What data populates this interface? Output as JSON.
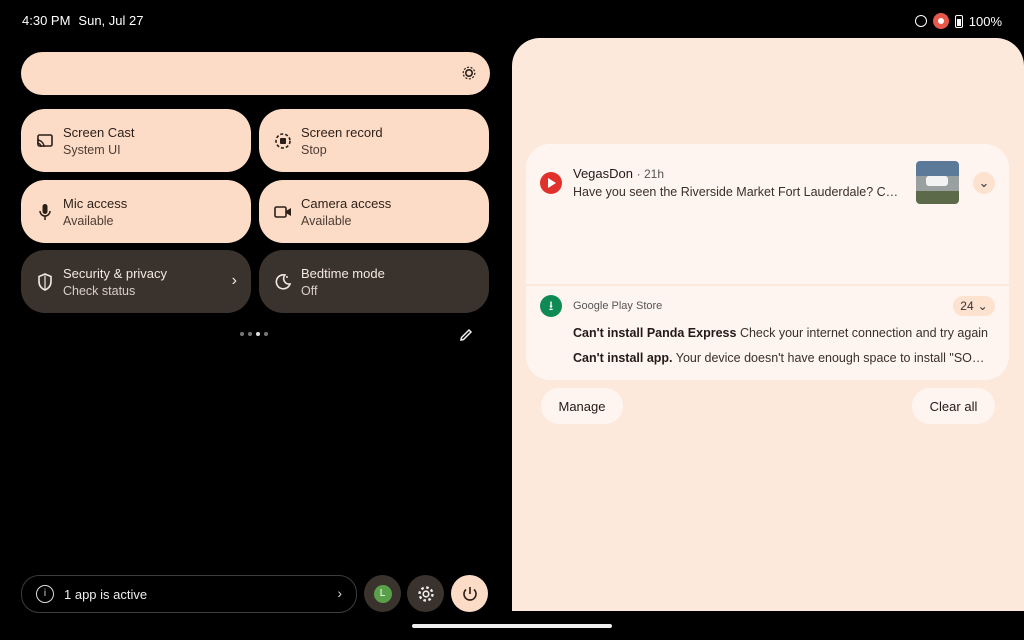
{
  "status_bar": {
    "time": "4:30 PM",
    "date": "Sun, Jul 27",
    "battery": "100%"
  },
  "tiles": [
    {
      "label": "Screen Cast",
      "sub": "System UI",
      "icon": "cast-icon"
    },
    {
      "label": "Screen record",
      "sub": "Stop",
      "icon": "screen-record-icon"
    },
    {
      "label": "Mic access",
      "sub": "Available",
      "icon": "microphone-icon"
    },
    {
      "label": "Camera access",
      "sub": "Available",
      "icon": "camera-icon"
    },
    {
      "label": "Security & privacy",
      "sub": "Check status",
      "icon": "shield-icon"
    },
    {
      "label": "Bedtime mode",
      "sub": "Off",
      "icon": "moon-icon"
    }
  ],
  "footer": {
    "active_apps": "1 app is active",
    "user_initial": "L"
  },
  "notifications": {
    "youtube": {
      "title": "VegasDon",
      "time": "21h",
      "body": "Have you seen the Riverside Market Fort Lauderdale? Check this out!"
    },
    "play_store": {
      "app": "Google Play Store",
      "count": "24",
      "lines": [
        {
          "title": "Can't install Panda Express",
          "text": "Check your internet connection and try again"
        },
        {
          "title": "Can't install app.",
          "text": "Your device doesn't have enough space to install \"SONIC\""
        }
      ]
    },
    "manage_label": "Manage",
    "clear_all_label": "Clear all"
  },
  "colors": {
    "tile": "#fddcc7",
    "tile_dark": "#3a322d",
    "shade": "#fde9dc",
    "card": "#fff5f0"
  }
}
